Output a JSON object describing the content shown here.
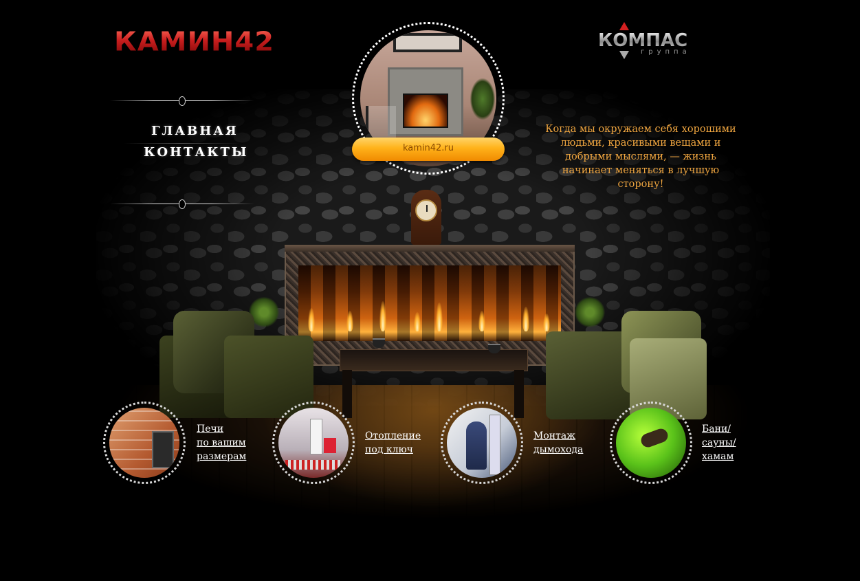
{
  "brand": {
    "logo_left": "КАМИН42",
    "logo_right_name": "КОМПАС",
    "logo_right_sub": "группа"
  },
  "nav": {
    "items": [
      {
        "label": "ГЛАВНАЯ"
      },
      {
        "label": "КОНТАКТЫ"
      }
    ]
  },
  "hero": {
    "banner": "kamin42.ru"
  },
  "quote": {
    "text": "Когда мы окружаем себя хорошими людьми, красивыми вещами и добрыми мыслями, — жизнь начинает меняться в лучшую сторону!"
  },
  "services": [
    {
      "lines": [
        "Печи",
        "по вашим",
        "размерам"
      ],
      "icon": "brick-stove-icon"
    },
    {
      "lines": [
        "Отопление",
        "под ключ"
      ],
      "icon": "heating-system-icon"
    },
    {
      "lines": [
        "Монтаж",
        "дымохода"
      ],
      "icon": "chimney-installer-icon"
    },
    {
      "lines": [
        "Бани/",
        "сауны/",
        "хамам"
      ],
      "icon": "sauna-icon"
    }
  ],
  "colors": {
    "background": "#000000",
    "accent_orange": "#f0a640",
    "banner": "#ffb21a",
    "logo_red": "#c81e1e"
  }
}
